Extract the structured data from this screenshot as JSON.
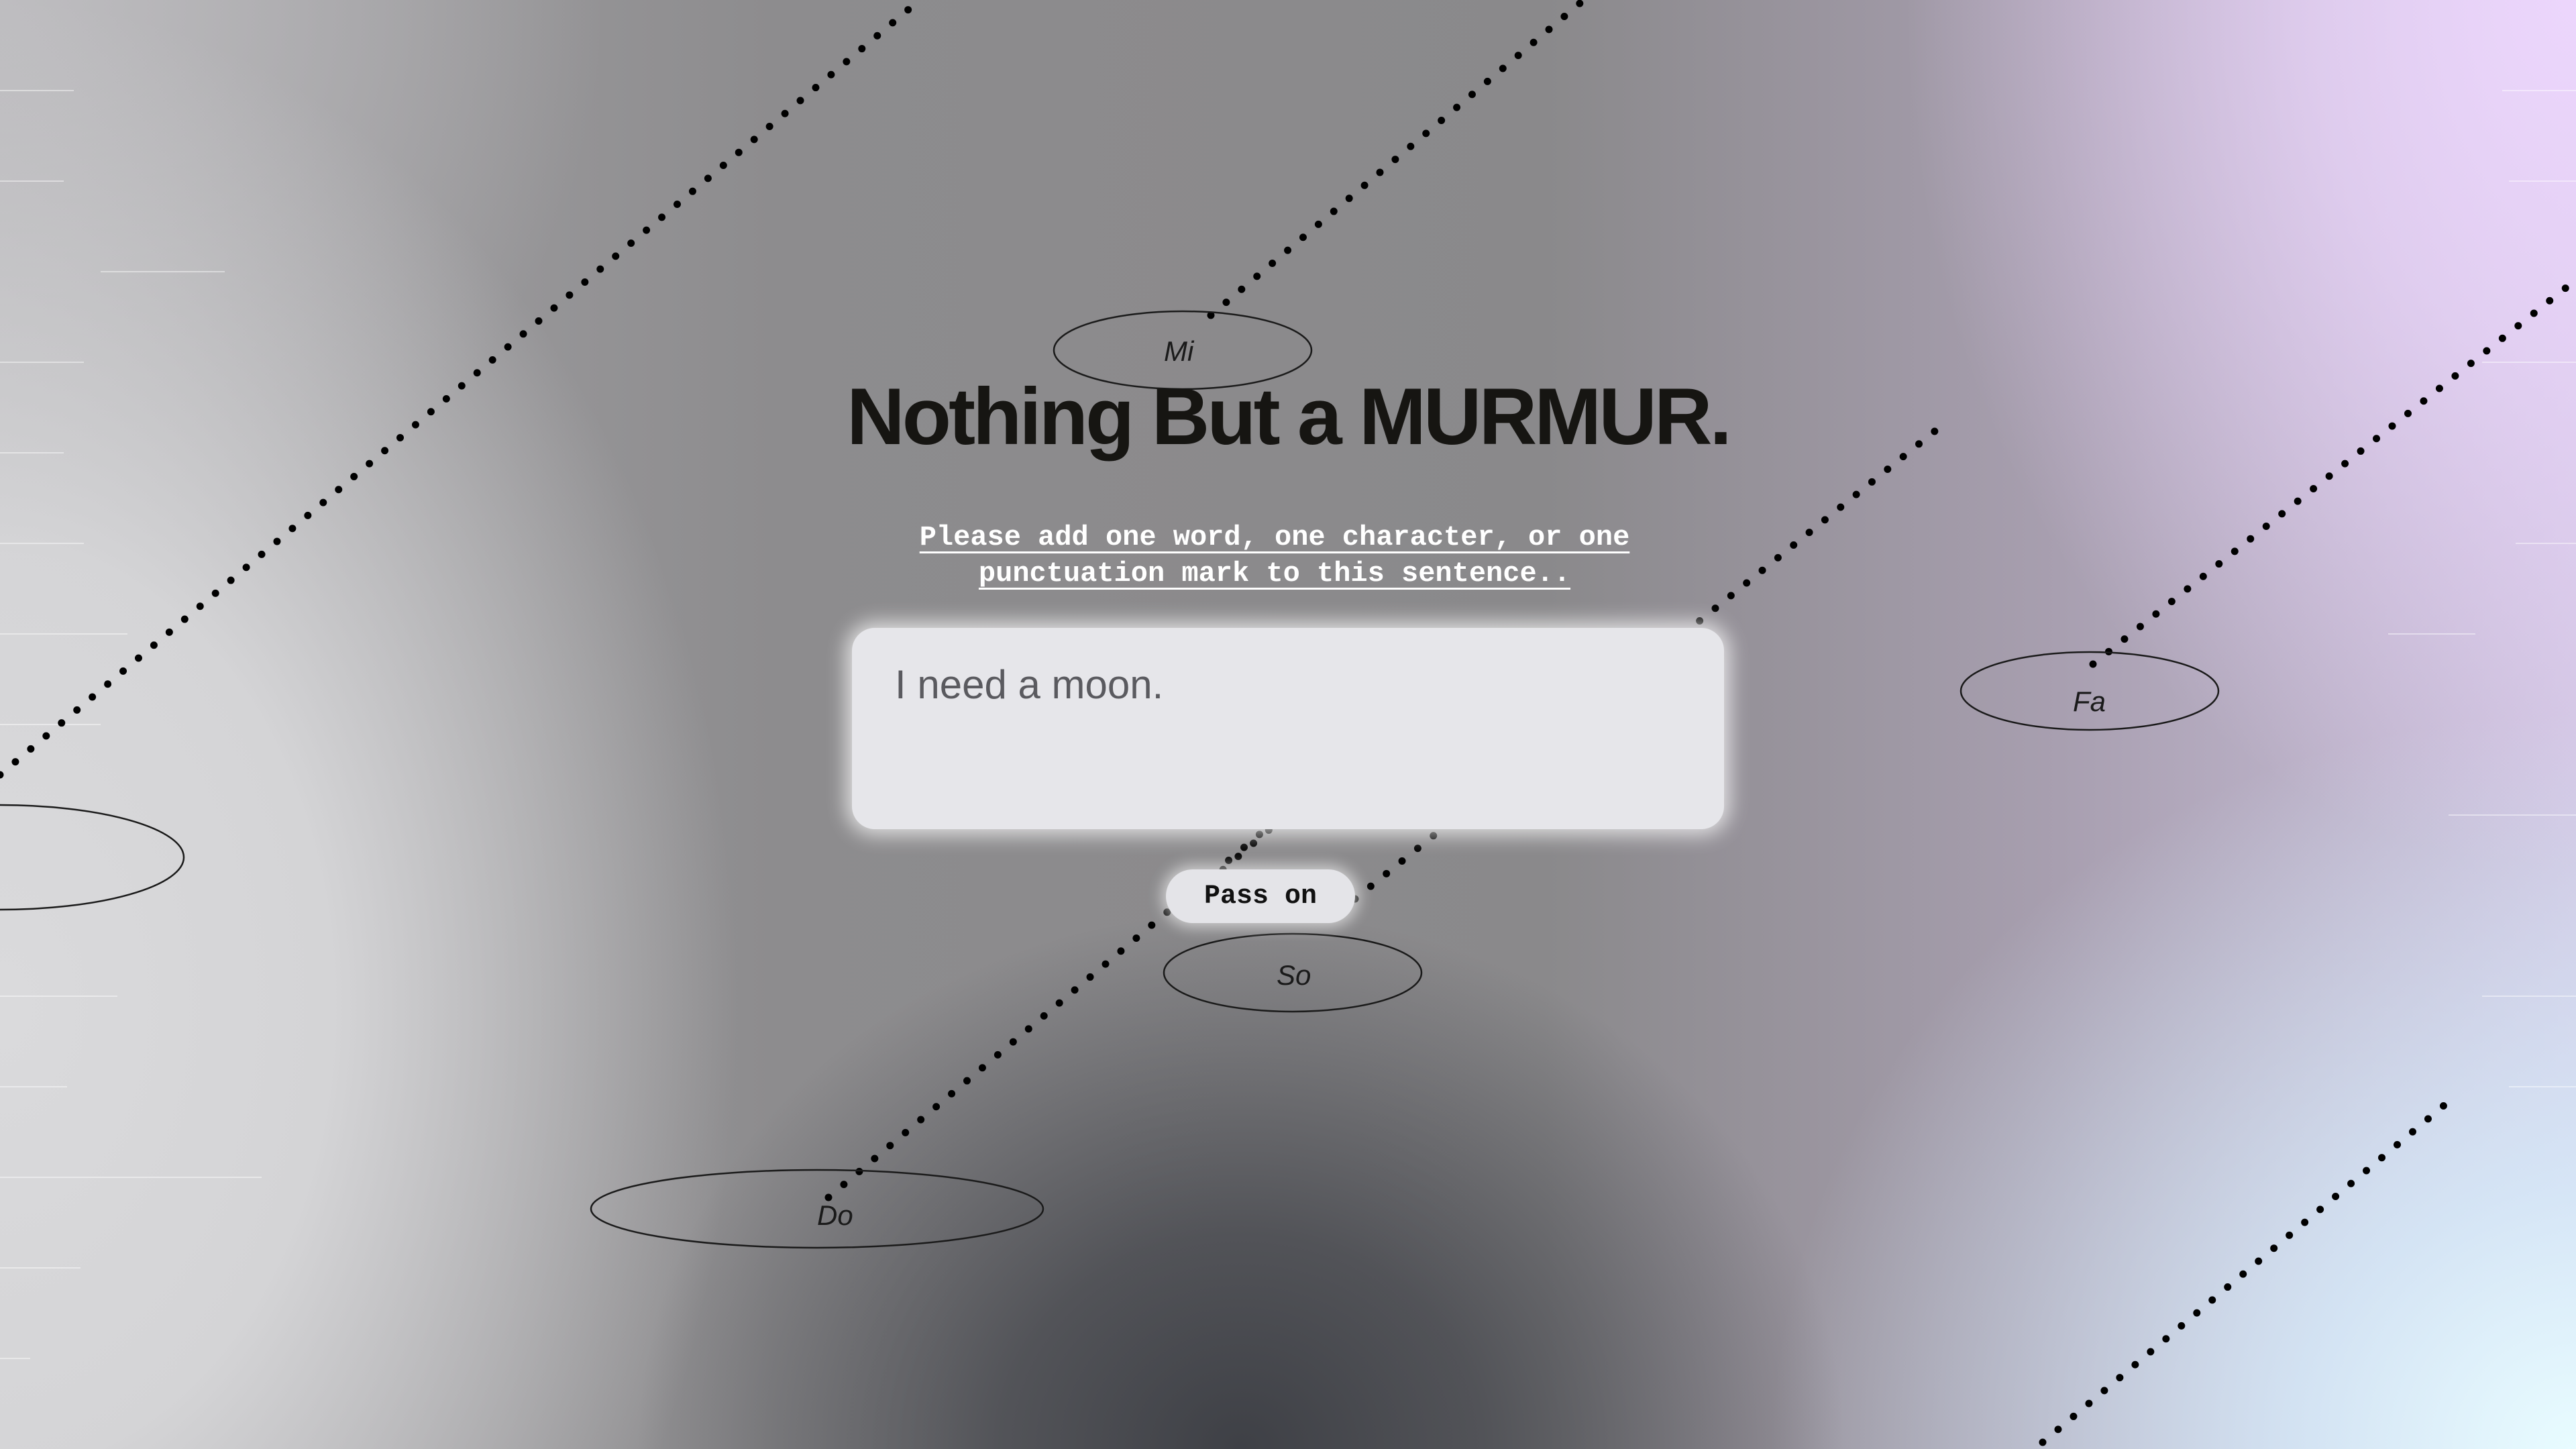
{
  "app": {
    "title": "Nothing But a MURMUR.",
    "instruction": "Please add one word, one character, or one punctuation mark to this sentence.."
  },
  "sentence_field": {
    "value": "I need a moon."
  },
  "pass_button": {
    "label": "Pass on"
  },
  "notes": [
    {
      "id": "mi",
      "label": "Mi"
    },
    {
      "id": "fa",
      "label": "Fa"
    },
    {
      "id": "so",
      "label": "So"
    },
    {
      "id": "do",
      "label": "Do"
    },
    {
      "id": "offscreen",
      "label": ""
    }
  ],
  "colors": {
    "title": "#161512",
    "instruction": "#ffffff",
    "field_bg": "#e6e6ea",
    "field_text": "#5a5a5f",
    "button_bg": "#e4e4e8",
    "dots": "#000000"
  }
}
